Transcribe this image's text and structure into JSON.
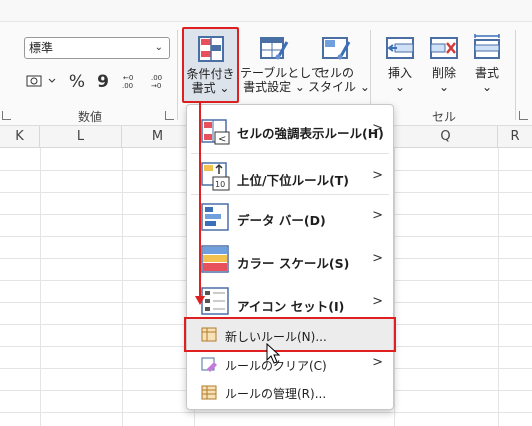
{
  "ribbon": {
    "number_format": "標準",
    "number_group_label": "数値",
    "percent_symbol": "%",
    "comma_symbol": "9",
    "cells_group_label": "セル",
    "buttons": {
      "conditional_formatting": [
        "条件付き",
        "書式 ⌄"
      ],
      "format_as_table": [
        "テーブルとして",
        "書式設定 ⌄"
      ],
      "cell_styles": [
        "セルの",
        "スタイル ⌄"
      ],
      "insert": [
        "挿入",
        "⌄"
      ],
      "delete": [
        "削除",
        "⌄"
      ],
      "format": [
        "書式",
        "⌄"
      ]
    }
  },
  "columns": [
    "K",
    "L",
    "M",
    "Q",
    "R"
  ],
  "menu": {
    "items": [
      {
        "label": "セルの強調表示ルール(H)",
        "has_submenu": true
      },
      {
        "label": "上位/下位ルール(T)",
        "has_submenu": true
      },
      {
        "label": "データ バー(D)",
        "has_submenu": true
      },
      {
        "label": "カラー スケール(S)",
        "has_submenu": true
      },
      {
        "label": "アイコン セット(I)",
        "has_submenu": true
      },
      {
        "label": "新しいルール(N)...",
        "has_submenu": false,
        "highlighted": true
      },
      {
        "label": "ルールのクリア(C)",
        "has_submenu": true
      },
      {
        "label": "ルールの管理(R)...",
        "has_submenu": false
      }
    ],
    "top_bottom_icon_number": "10",
    "arrow_glyph": ">"
  },
  "colors": {
    "highlight_outline": "#e02020",
    "ribbon_bg": "#fafafa",
    "icon_blue": "#4a6fa5"
  }
}
